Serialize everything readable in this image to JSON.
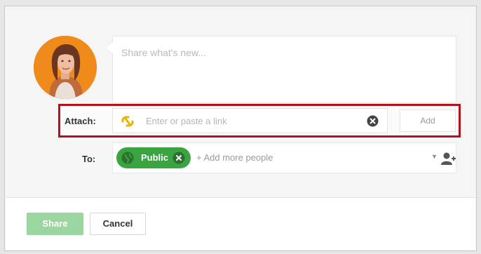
{
  "compose": {
    "placeholder": "Share what's new..."
  },
  "attach": {
    "label": "Attach:",
    "link_placeholder": "Enter or paste a link",
    "add_label": "Add"
  },
  "to": {
    "label": "To:",
    "chip_label": "Public",
    "add_people": "+ Add more people"
  },
  "footer": {
    "share_label": "Share",
    "cancel_label": "Cancel"
  },
  "icons": {
    "link": "link-icon",
    "clear": "clear-icon",
    "globe": "globe-icon",
    "chip_remove": "close-icon",
    "dropdown": "chevron-down-icon",
    "add_person": "add-person-icon"
  },
  "colors": {
    "highlight": "#b0131f",
    "public_chip": "#3aa441",
    "share_button": "#9bd59f",
    "link_icon": "#e8b400"
  }
}
